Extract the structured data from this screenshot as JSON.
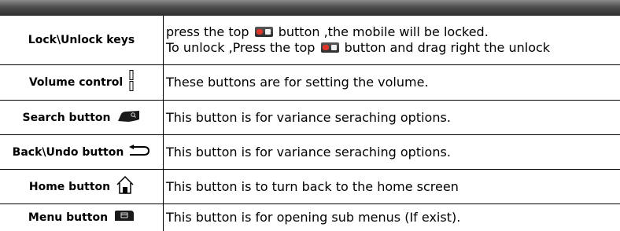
{
  "rows": [
    {
      "label": "Lock\\Unlock keys",
      "icon": "",
      "desc_lines": [
        {
          "before": "press the top ",
          "icon": "lock-button-icon",
          "after": " button ,the mobile will be locked."
        },
        {
          "before": "To unlock ,Press the top ",
          "icon": "lock-button-icon",
          "after": " button and drag right the unlock"
        }
      ]
    },
    {
      "label": "Volume control",
      "icon": "volume-keys-icon",
      "desc": "These buttons are for setting the volume."
    },
    {
      "label": "Search button",
      "icon": "search-key-icon",
      "desc": "This button is for variance seraching options."
    },
    {
      "label": "Back\\Undo button",
      "icon": "back-arrow-icon",
      "desc": "This button is for variance seraching options."
    },
    {
      "label": "Home button",
      "icon": "home-icon",
      "desc": "This button is to turn back to the home screen"
    },
    {
      "label": "Menu button",
      "icon": "menu-key-icon",
      "desc": "This button is for opening sub menus (If exist)."
    }
  ],
  "colors": {
    "lock_button_red": "#e0352b",
    "header_bar": "#3a3a3a"
  }
}
